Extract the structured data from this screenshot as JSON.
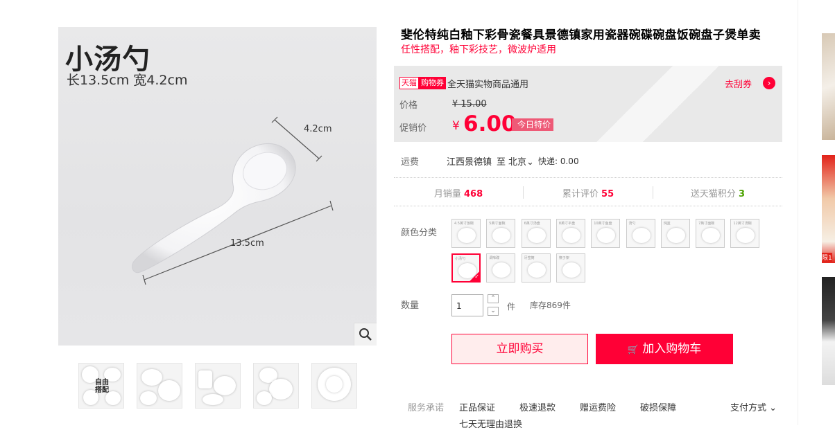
{
  "gallery": {
    "main_image": {
      "title": "小汤勺",
      "size_text": "长13.5cm 宽4.2cm",
      "width_label": "4.2cm",
      "length_label": "13.5cm"
    },
    "thumb_badge": "自由搭配"
  },
  "product": {
    "title": "斐伦特纯白釉下彩骨瓷餐具景德镇家用瓷器碗碟碗盘饭碗盘子煲单卖",
    "subtitle": "任性搭配，釉下彩技艺，微波炉适用"
  },
  "coupon": {
    "tmall_tag": "天猫",
    "coupon_tag": "购物券",
    "desc": "全天猫实物商品通用",
    "link": "去刮券",
    "arrow_icon": "›"
  },
  "price": {
    "label": "价格",
    "original": "¥ 15.00",
    "promo_label": "促销价",
    "currency": "¥",
    "promo_value": "6.00",
    "badge": "今日特价",
    "accent_color": "#ff0036"
  },
  "shipping": {
    "label": "运费",
    "from": "江西景德镇",
    "to_prefix": "至",
    "to_city": "北京",
    "chevron_icon": "⌄",
    "info": "快递: 0.00"
  },
  "stats": {
    "monthly_label": "月销量",
    "monthly_value": "468",
    "reviews_label": "累计评价",
    "reviews_value": "55",
    "points_label": "送天猫积分",
    "points_value": "3"
  },
  "sku": {
    "label": "颜色分类",
    "options": [
      {
        "text": "4.5英寸饭碗"
      },
      {
        "text": "5英寸面碗"
      },
      {
        "text": "6英寸汤盘"
      },
      {
        "text": "8英寸平盘"
      },
      {
        "text": "10英寸鱼盘"
      },
      {
        "text": "汤勺"
      },
      {
        "text": "炖盅"
      },
      {
        "text": "7英寸面碗"
      },
      {
        "text": "12英寸汤碗"
      },
      {
        "text": "小汤勺",
        "selected": true
      },
      {
        "text": "调味碟"
      },
      {
        "text": "牙签筒"
      },
      {
        "text": "筷子架"
      }
    ]
  },
  "quantity": {
    "label": "数量",
    "value": "1",
    "up_icon": "⌃",
    "down_icon": "⌄",
    "unit": "件",
    "stock": "库存869件"
  },
  "actions": {
    "buy_now": "立即购买",
    "cart_icon": "🛒",
    "add_to_cart": "加入购物车"
  },
  "services": {
    "label": "服务承诺",
    "items": [
      "正品保证",
      "极速退款",
      "赠运费险",
      "破损保障"
    ],
    "more": "七天无理由退换",
    "payment": "支付方式",
    "payment_chevron": "⌄"
  },
  "side": {
    "badge": "限1"
  }
}
